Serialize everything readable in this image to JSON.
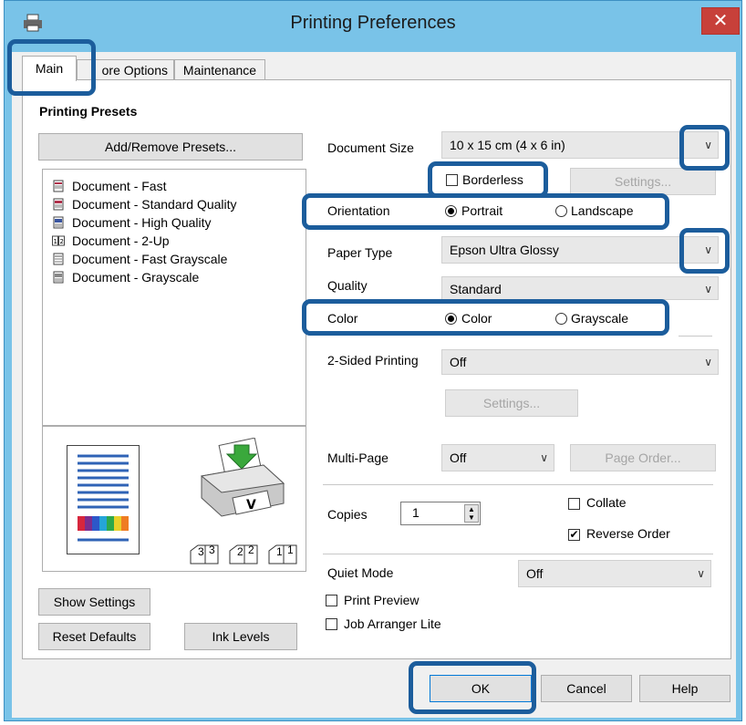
{
  "window": {
    "title": "Printing Preferences",
    "close_glyph": "✕",
    "app_icon": "printer-icon"
  },
  "tabs": [
    {
      "label": "Main",
      "active": true
    },
    {
      "label": "ore Options"
    },
    {
      "label": "Maintenance"
    }
  ],
  "presets": {
    "heading": "Printing Presets",
    "add_remove_label": "Add/Remove Presets...",
    "items": [
      {
        "label": "Document - Fast",
        "icon": "document-fast-icon"
      },
      {
        "label": "Document - Standard Quality",
        "icon": "document-standard-icon"
      },
      {
        "label": "Document - High Quality",
        "icon": "document-high-icon"
      },
      {
        "label": "Document - 2-Up",
        "icon": "document-2up-icon"
      },
      {
        "label": "Document - Fast Grayscale",
        "icon": "document-fast-gray-icon"
      },
      {
        "label": "Document - Grayscale",
        "icon": "document-gray-icon"
      }
    ]
  },
  "preview": {
    "page_numbers": [
      "3",
      "3",
      "2",
      "2",
      "1",
      "1"
    ]
  },
  "settings": {
    "document_size": {
      "label": "Document Size",
      "value": "10 x 15 cm (4 x 6 in)"
    },
    "borderless": {
      "label": "Borderless",
      "checked": false
    },
    "borderless_settings_label": "Settings...",
    "orientation": {
      "label": "Orientation",
      "portrait": "Portrait",
      "landscape": "Landscape",
      "selected": "Portrait"
    },
    "paper_type": {
      "label": "Paper Type",
      "value": "Epson Ultra Glossy"
    },
    "quality": {
      "label": "Quality",
      "value": "Standard"
    },
    "color": {
      "label": "Color",
      "color_option": "Color",
      "grayscale_option": "Grayscale",
      "selected": "Color"
    },
    "two_sided": {
      "label": "2-Sided Printing",
      "value": "Off",
      "settings_label": "Settings..."
    },
    "multi_page": {
      "label": "Multi-Page",
      "value": "Off",
      "page_order_label": "Page Order..."
    },
    "copies": {
      "label": "Copies",
      "value": "1"
    },
    "collate": {
      "label": "Collate",
      "checked": false
    },
    "reverse_order": {
      "label": "Reverse Order",
      "checked": true
    },
    "quiet_mode": {
      "label": "Quiet Mode",
      "value": "Off"
    },
    "print_preview": {
      "label": "Print Preview",
      "checked": false
    },
    "job_arranger": {
      "label": "Job Arranger Lite",
      "checked": false
    }
  },
  "buttons": {
    "show_settings": "Show Settings",
    "reset_defaults": "Reset Defaults",
    "ink_levels": "Ink Levels",
    "ok": "OK",
    "cancel": "Cancel",
    "help": "Help"
  },
  "colors": {
    "titlebar": "#79c3e8",
    "highlight": "#1c5d9c",
    "close": "#c7403a"
  }
}
